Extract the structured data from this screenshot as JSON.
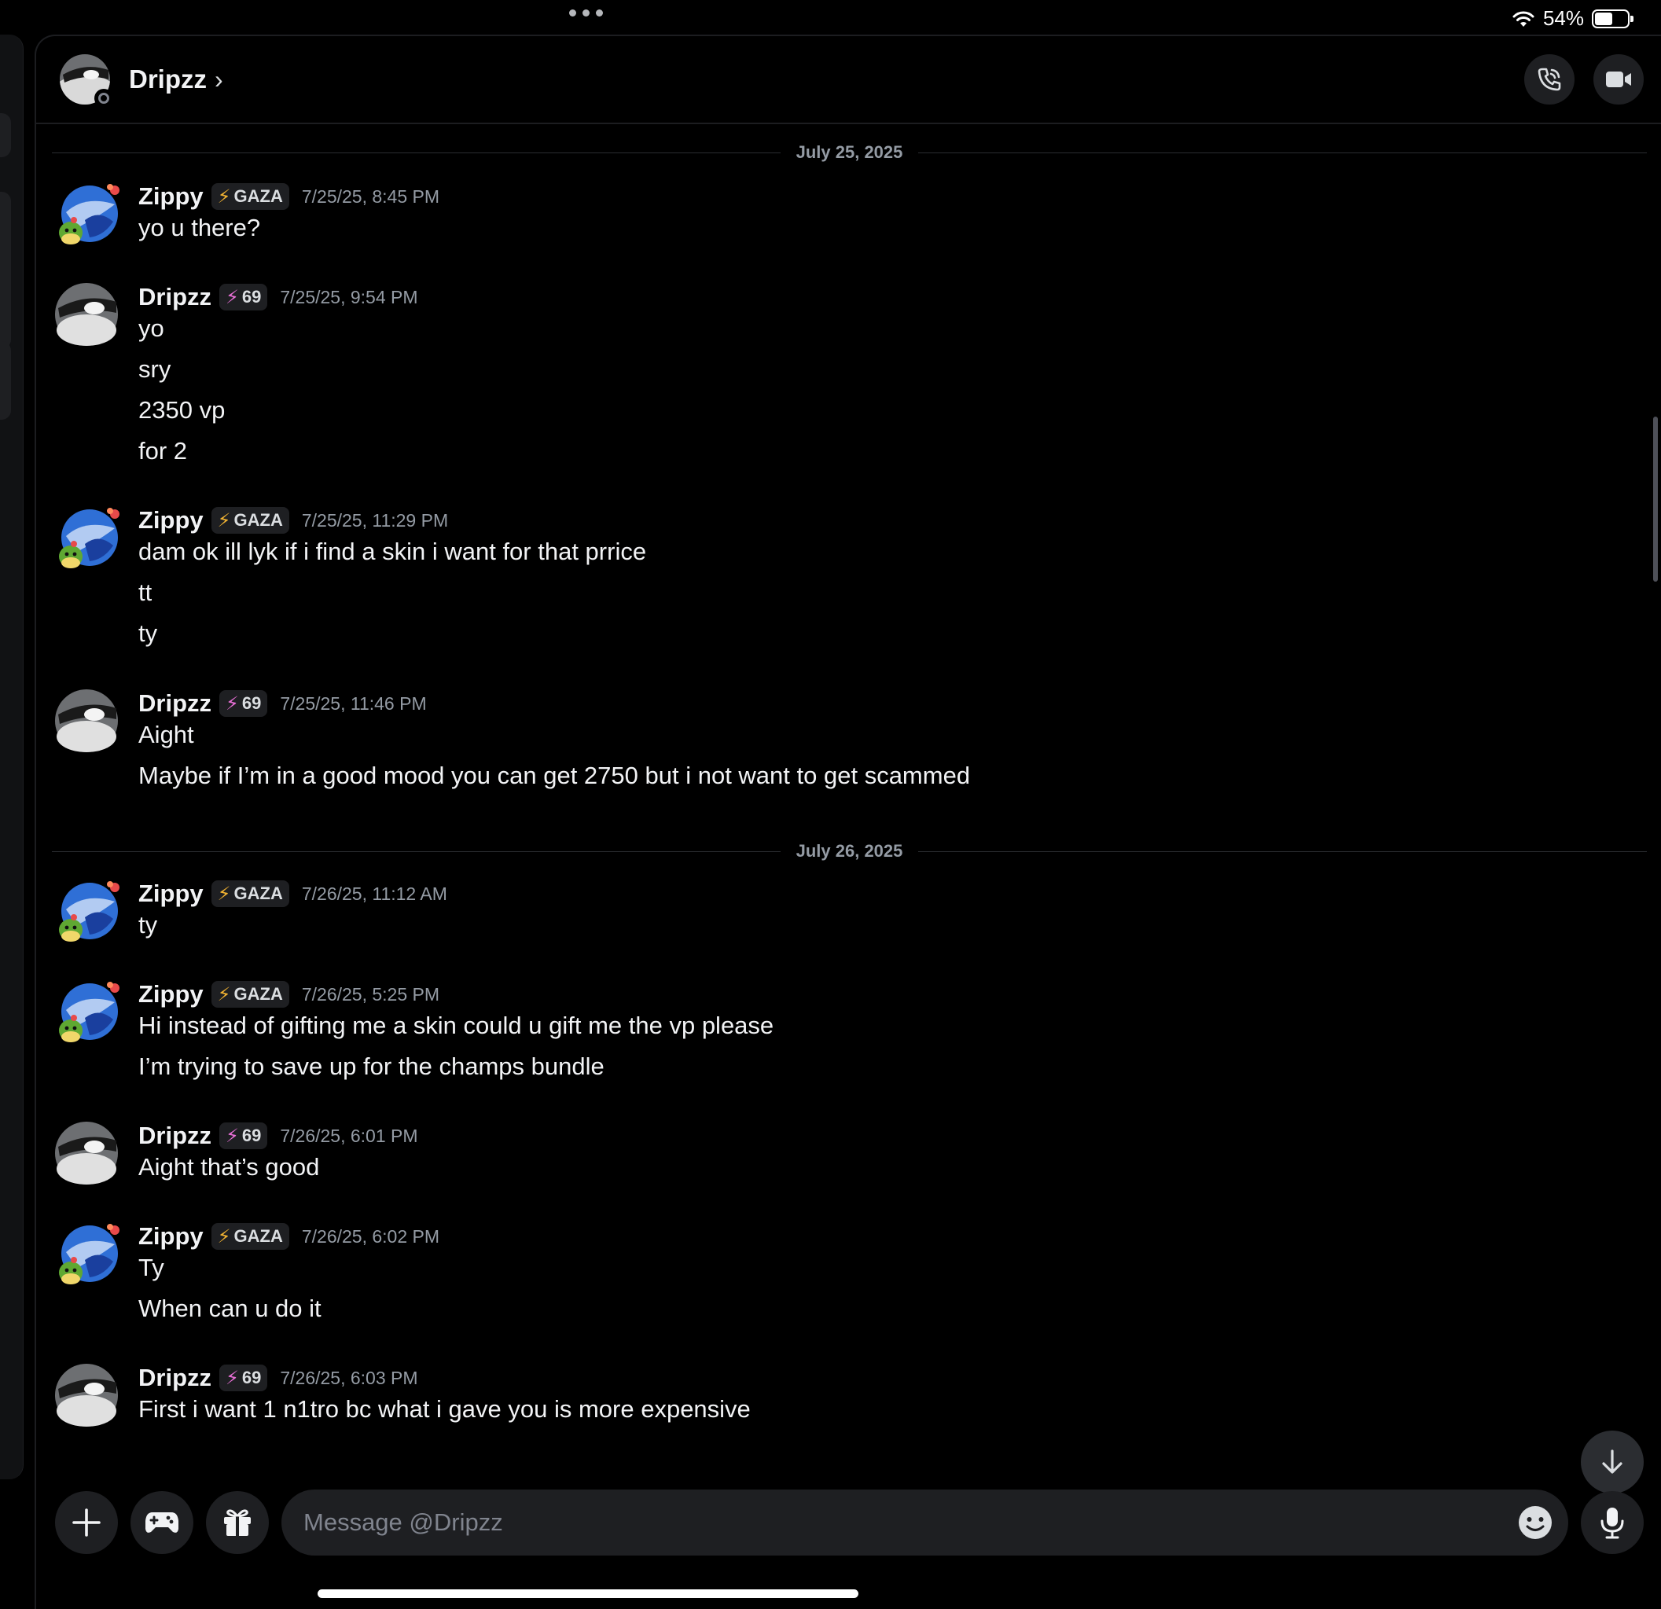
{
  "status_bar": {
    "battery_text": "54%",
    "battery_level": 0.54
  },
  "header": {
    "title": "Dripzz",
    "chevron": "›"
  },
  "dates": [
    "July 25, 2025",
    "July 26, 2025"
  ],
  "users": {
    "zippy": {
      "name": "Zippy",
      "tag": "GAZA"
    },
    "dripzz": {
      "name": "Dripzz",
      "tag": "69"
    }
  },
  "messages": [
    {
      "user": "Zippy",
      "tag": "GAZA",
      "time": "7/25/25, 8:45 PM",
      "lines": [
        "yo u there?"
      ]
    },
    {
      "user": "Dripzz",
      "tag": "69",
      "time": "7/25/25, 9:54 PM",
      "lines": [
        "yo",
        "sry",
        "2350 vp",
        "for 2"
      ]
    },
    {
      "user": "Zippy",
      "tag": "GAZA",
      "time": "7/25/25, 11:29 PM",
      "lines": [
        "dam ok ill lyk if i find a skin i want for that prrice",
        "tt",
        "ty"
      ]
    },
    {
      "user": "Dripzz",
      "tag": "69",
      "time": "7/25/25, 11:46 PM",
      "lines": [
        "Aight",
        "Maybe if I’m in a good mood you can get 2750 but i not want to get scammed"
      ]
    },
    {
      "user": "Zippy",
      "tag": "GAZA",
      "time": "7/26/25, 11:12 AM",
      "lines": [
        "ty"
      ]
    },
    {
      "user": "Zippy",
      "tag": "GAZA",
      "time": "7/26/25, 5:25 PM",
      "lines": [
        "Hi instead of gifting me a skin could u gift me the vp please",
        "I’m trying to save up for the champs bundle"
      ]
    },
    {
      "user": "Dripzz",
      "tag": "69",
      "time": "7/26/25, 6:01 PM",
      "lines": [
        "Aight that’s good"
      ]
    },
    {
      "user": "Zippy",
      "tag": "GAZA",
      "time": "7/26/25, 6:02 PM",
      "lines": [
        "Ty",
        "When can u do it"
      ]
    },
    {
      "user": "Dripzz",
      "tag": "69",
      "time": "7/26/25, 6:03 PM",
      "lines": [
        "First i want 1 n1tro bc what i gave you is more expensive"
      ]
    }
  ],
  "composer": {
    "placeholder": "Message @Dripzz"
  },
  "icons": {
    "header": [
      "phone-icon",
      "video-camera-icon"
    ],
    "composer": [
      "plus-icon",
      "gamepad-icon",
      "gift-icon",
      "emoji-icon",
      "microphone-icon"
    ],
    "scroll": "arrow-down-icon"
  },
  "colors": {
    "background": "#000000",
    "surface": "#1e1f22",
    "muted_text": "#949ba4",
    "gaza_bolt": "#f0b232",
    "tag69_bolt": "#e86fd6"
  }
}
